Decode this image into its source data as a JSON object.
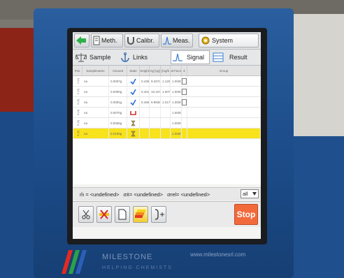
{
  "toolbar_top": {
    "back_arrow": "arrow-left-icon",
    "meth": "Meth.",
    "calibr": "Calibr.",
    "meas": "Meas.",
    "system": "System"
  },
  "toolbar_second": {
    "sample": "Sample",
    "links": "Links",
    "signal": "Signal",
    "result": "Result"
  },
  "table": {
    "headers": [
      "Pos",
      "Samplename",
      "Amount",
      "State",
      "Height",
      "Hg [ng]",
      "[mg/k",
      "Cal Factor",
      "Σ",
      "Group"
    ],
    "rows": [
      {
        "pos": "1 (1)",
        "name": "na",
        "amount": "0.0097g",
        "state": "check",
        "height": "0.4360",
        "hg": "9.3373",
        "conc": "1.1206",
        "cal": "1.0000"
      },
      {
        "pos": "2 (2)",
        "name": "na",
        "amount": "0.0090g",
        "state": "check",
        "height": "0.4017",
        "hg": "10.1075",
        "conc": "1.0079",
        "cal": "1.0000"
      },
      {
        "pos": "3 (3)",
        "name": "na",
        "amount": "0.0081g",
        "state": "check",
        "height": "0.4664",
        "hg": "9.9836",
        "conc": "1.0170",
        "cal": "1.0000"
      },
      {
        "pos": "4 (4)",
        "name": "na",
        "amount": "0.0070g",
        "state": "boat",
        "height": "",
        "hg": "",
        "conc": "",
        "cal": "1.0000"
      },
      {
        "pos": "5 (5)",
        "name": "na",
        "amount": "0.0066g",
        "state": "hourglass",
        "height": "",
        "hg": "",
        "conc": "",
        "cal": "1.0000"
      },
      {
        "pos": "6 (6)",
        "name": "na",
        "amount": "0.0100g",
        "state": "hourglass",
        "height": "",
        "hg": "",
        "conc": "",
        "cal": "1.0000"
      }
    ],
    "selected_row": 5
  },
  "statusbar": {
    "mean": "m̄ = <undefined>",
    "sigma": "σx̄= <undefined>",
    "sigma_rel": "σrel= <undefined>",
    "filter_value": "all"
  },
  "bottom": {
    "stop": "Stop"
  },
  "brand": {
    "name": "MILESTONE",
    "sub": "HELPING CHEMISTS",
    "url": "www.milestonesrl.com"
  },
  "colors": {
    "selected_row": "#f7e21c",
    "stop_button": "#f26a3b",
    "check": "#2a6fd6"
  }
}
